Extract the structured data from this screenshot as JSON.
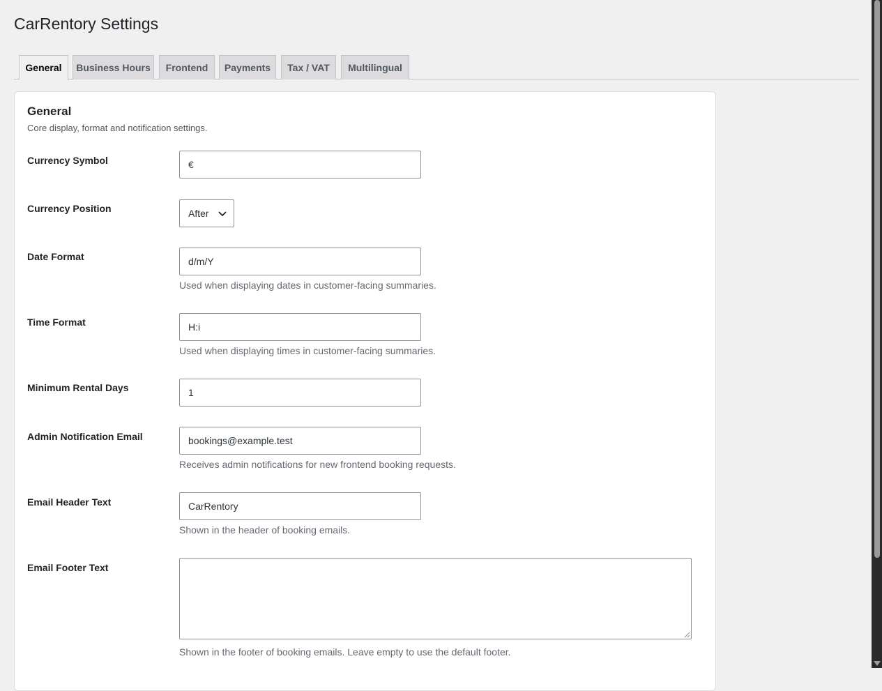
{
  "page": {
    "title": "CarRentory Settings"
  },
  "tabs": [
    {
      "label": "General",
      "active": true
    },
    {
      "label": "Business Hours",
      "active": false
    },
    {
      "label": "Frontend",
      "active": false
    },
    {
      "label": "Payments",
      "active": false
    },
    {
      "label": "Tax / VAT",
      "active": false
    },
    {
      "label": "Multilingual",
      "active": false
    }
  ],
  "section": {
    "title": "General",
    "description": "Core display, format and notification settings."
  },
  "fields": {
    "currency_symbol": {
      "label": "Currency Symbol",
      "value": "€"
    },
    "currency_position": {
      "label": "Currency Position",
      "value": "After",
      "icon": "chevron-down-icon"
    },
    "date_format": {
      "label": "Date Format",
      "value": "d/m/Y",
      "help": "Used when displaying dates in customer-facing summaries."
    },
    "time_format": {
      "label": "Time Format",
      "value": "H:i",
      "help": "Used when displaying times in customer-facing summaries."
    },
    "min_rental_days": {
      "label": "Minimum Rental Days",
      "value": "1"
    },
    "admin_email": {
      "label": "Admin Notification Email",
      "value": "bookings@example.test",
      "help": "Receives admin notifications for new frontend booking requests."
    },
    "email_header": {
      "label": "Email Header Text",
      "value": "CarRentory",
      "help": "Shown in the header of booking emails."
    },
    "email_footer": {
      "label": "Email Footer Text",
      "value": "",
      "help": "Shown in the footer of booking emails. Leave empty to use the default footer."
    }
  },
  "colors": {
    "page_background": "#f0f0f1",
    "card_background": "#ffffff",
    "input_border": "#8c8f94",
    "tab_inactive_background": "#dcdcde",
    "help_text": "#646970"
  }
}
